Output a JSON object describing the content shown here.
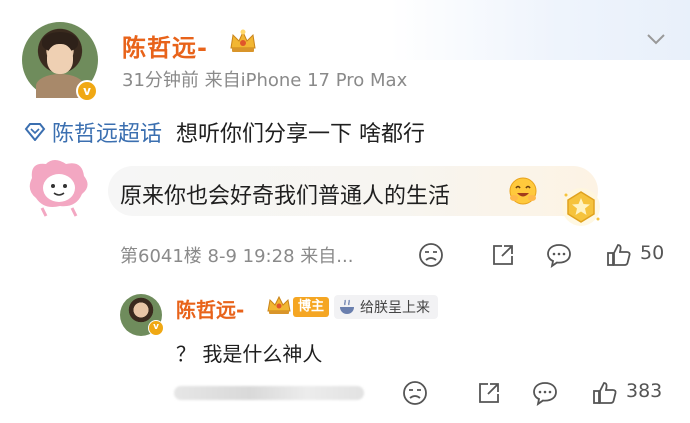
{
  "post": {
    "author": "陈哲远-",
    "time_source": "31分钟前  来自iPhone 17 Pro Max",
    "verified_badge": "v",
    "topic": "陈哲远超话",
    "text": "想听你们分享一下 啥都行"
  },
  "comment": {
    "text": "原来你也会好奇我们普通人的生活",
    "floor_info": "第6041楼 8-9 19:28 来自...",
    "likes": "50"
  },
  "reply": {
    "author": "陈哲远-",
    "role_badge": "博主",
    "liked_tag": "给朕呈上来",
    "verified_badge": "v",
    "text": "？ 我是什么神人",
    "likes": "383"
  },
  "colors": {
    "name_orange": "#e8631a",
    "topic_blue": "#3b6fb0",
    "meta_gray": "#8a8a8a",
    "badge_gold": "#f5a623"
  },
  "icons": [
    "chevron-down-icon",
    "crown-icon",
    "topic-diamond-icon",
    "dislike-icon",
    "share-icon",
    "comment-icon",
    "like-icon",
    "coin-icon",
    "smile-emoji-icon",
    "bowl-icon"
  ]
}
